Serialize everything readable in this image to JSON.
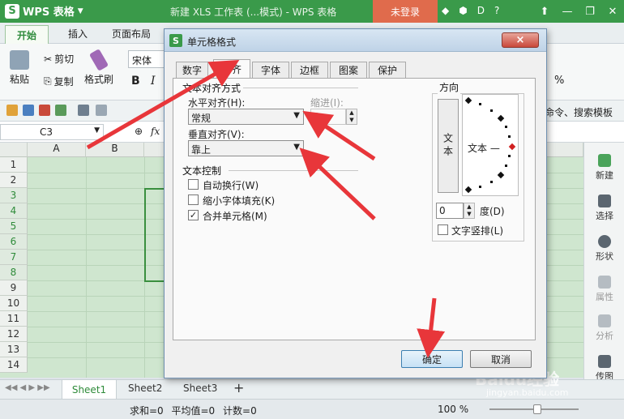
{
  "titlebar": {
    "app_name": "WPS 表格",
    "doc_title": "新建 XLS 工作表 (...模式) - WPS 表格",
    "login": "未登录"
  },
  "ribbon": {
    "tabs": [
      "开始",
      "插入",
      "页面布局"
    ],
    "paste": "粘贴",
    "cut": "剪切",
    "copy": "复制",
    "format_painter": "格式刷",
    "font_name": "宋体",
    "bold": "B",
    "italic": "I",
    "percent": "%",
    "right_cmd": "命令、搜索模板"
  },
  "formula_bar": {
    "cell_ref": "C3",
    "fx": "fx"
  },
  "grid": {
    "columns": [
      "A",
      "B"
    ],
    "rows": [
      "1",
      "2",
      "3",
      "4",
      "5",
      "6",
      "7",
      "8",
      "9",
      "10",
      "11",
      "12",
      "13",
      "14"
    ],
    "selected_rows": [
      "3",
      "4",
      "5",
      "6",
      "7",
      "8"
    ]
  },
  "right_panel": {
    "items": [
      "新建",
      "选择",
      "形状",
      "属性",
      "分析",
      "传图"
    ]
  },
  "sheets": {
    "tabs": [
      "Sheet1",
      "Sheet2",
      "Sheet3"
    ],
    "add": "+"
  },
  "status": {
    "summary": "求和=0 平均值=0 计数=0",
    "zoom": "100 %"
  },
  "dialog": {
    "title": "单元格格式",
    "close": "×",
    "tabs": [
      "数字",
      "对齐",
      "字体",
      "边框",
      "图案",
      "保护"
    ],
    "active_tab": "对齐",
    "text_align_group": "文本对齐方式",
    "horizontal_label": "水平对齐(H):",
    "horizontal_value": "常规",
    "indent_label": "缩进(I):",
    "indent_value": "0",
    "vertical_label": "垂直对齐(V):",
    "vertical_value": "靠上",
    "text_control_group": "文本控制",
    "wrap_text": "自动换行(W)",
    "shrink_fit": "缩小字体填充(K)",
    "merge_cells": "合并单元格(M)",
    "wrap_checked": false,
    "shrink_checked": false,
    "merge_checked": true,
    "orientation_group": "方向",
    "vertical_text_button": "文本",
    "dial_text": "文本 —",
    "degrees_value": "0",
    "degrees_label": "度(D)",
    "vertical_text_label": "文字竖排(L)",
    "ok": "确定",
    "cancel": "取消"
  },
  "watermark": {
    "text": "Baidu经验",
    "url": "jingyan.baidu.com"
  },
  "colors": {
    "brand_green": "#3a9a4a",
    "arrow_red": "#e8363a",
    "login_orange": "#e06b4c"
  }
}
